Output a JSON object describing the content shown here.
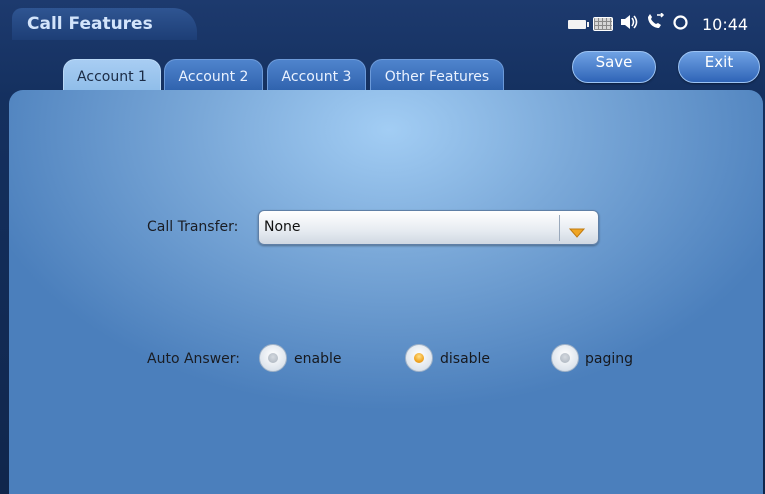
{
  "app": {
    "title": "Call Features"
  },
  "status_bar": {
    "time": "10:44",
    "icons": [
      "battery-icon",
      "keyboard-icon",
      "speaker-volume-icon",
      "call-forward-icon",
      "sync-icon"
    ]
  },
  "toolbar": {
    "save_label": "Save",
    "exit_label": "Exit"
  },
  "tabs": [
    {
      "label": "Account 1",
      "active": true
    },
    {
      "label": "Account 2",
      "active": false
    },
    {
      "label": "Account 3",
      "active": false
    },
    {
      "label": "Other Features",
      "active": false
    }
  ],
  "form": {
    "call_transfer": {
      "label": "Call Transfer:",
      "value": "None"
    },
    "auto_answer": {
      "label": "Auto Answer:",
      "options": [
        {
          "label": "enable",
          "selected": false
        },
        {
          "label": "disable",
          "selected": true
        },
        {
          "label": "paging",
          "selected": false
        }
      ]
    }
  },
  "colors": {
    "accent": "#f0a523",
    "panel": "#7aa8d8",
    "background": "#14305f"
  }
}
